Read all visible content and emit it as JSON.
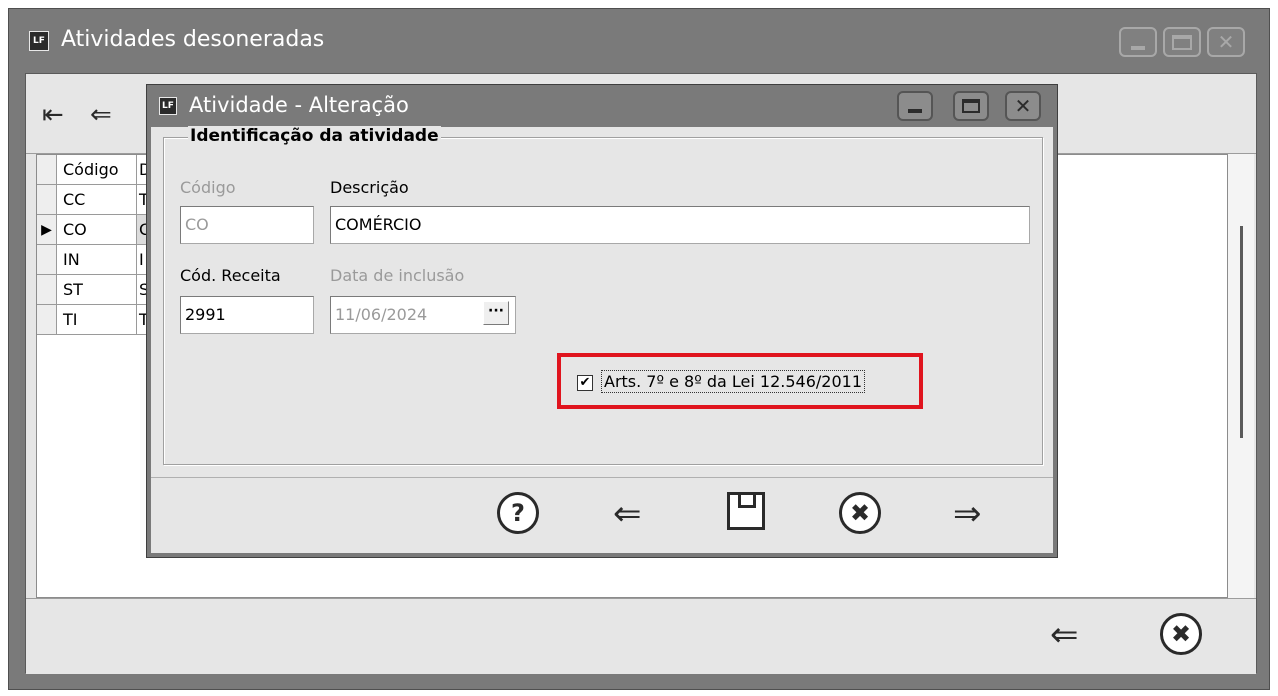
{
  "outer_window": {
    "title": "Atividades desoneradas",
    "icon_text": "LF"
  },
  "grid": {
    "header": {
      "col1": "Código",
      "col2": "D"
    },
    "rows": [
      {
        "code": "CC",
        "desc": "T",
        "selected": false
      },
      {
        "code": "CO",
        "desc": "C",
        "selected": true
      },
      {
        "code": "IN",
        "desc": "I",
        "selected": false
      },
      {
        "code": "ST",
        "desc": "S",
        "selected": false
      },
      {
        "code": "TI",
        "desc": "T",
        "selected": false
      }
    ],
    "row_pointer": "▶"
  },
  "dialog": {
    "title": "Atividade - Alteração",
    "icon_text": "LF",
    "group_title": "Identificação da atividade",
    "codigo": {
      "label": "Código",
      "value": "CO"
    },
    "descricao": {
      "label": "Descrição",
      "value": "COMÉRCIO"
    },
    "cod_receita": {
      "label": "Cód. Receita",
      "value": "2991"
    },
    "data_inclusao": {
      "label": "Data de inclusão",
      "value": "11/06/2024",
      "button": "···"
    },
    "checkbox": {
      "checked": true,
      "mark": "✔",
      "label": "Arts. 7º e 8º da Lei 12.546/2011"
    },
    "highlight_color": "#e0141e"
  },
  "icons": {
    "help": "?",
    "cancel": "✖",
    "arrow_left": "⇐",
    "arrow_right": "⇒",
    "first": "⇤",
    "window_close": "✕"
  }
}
